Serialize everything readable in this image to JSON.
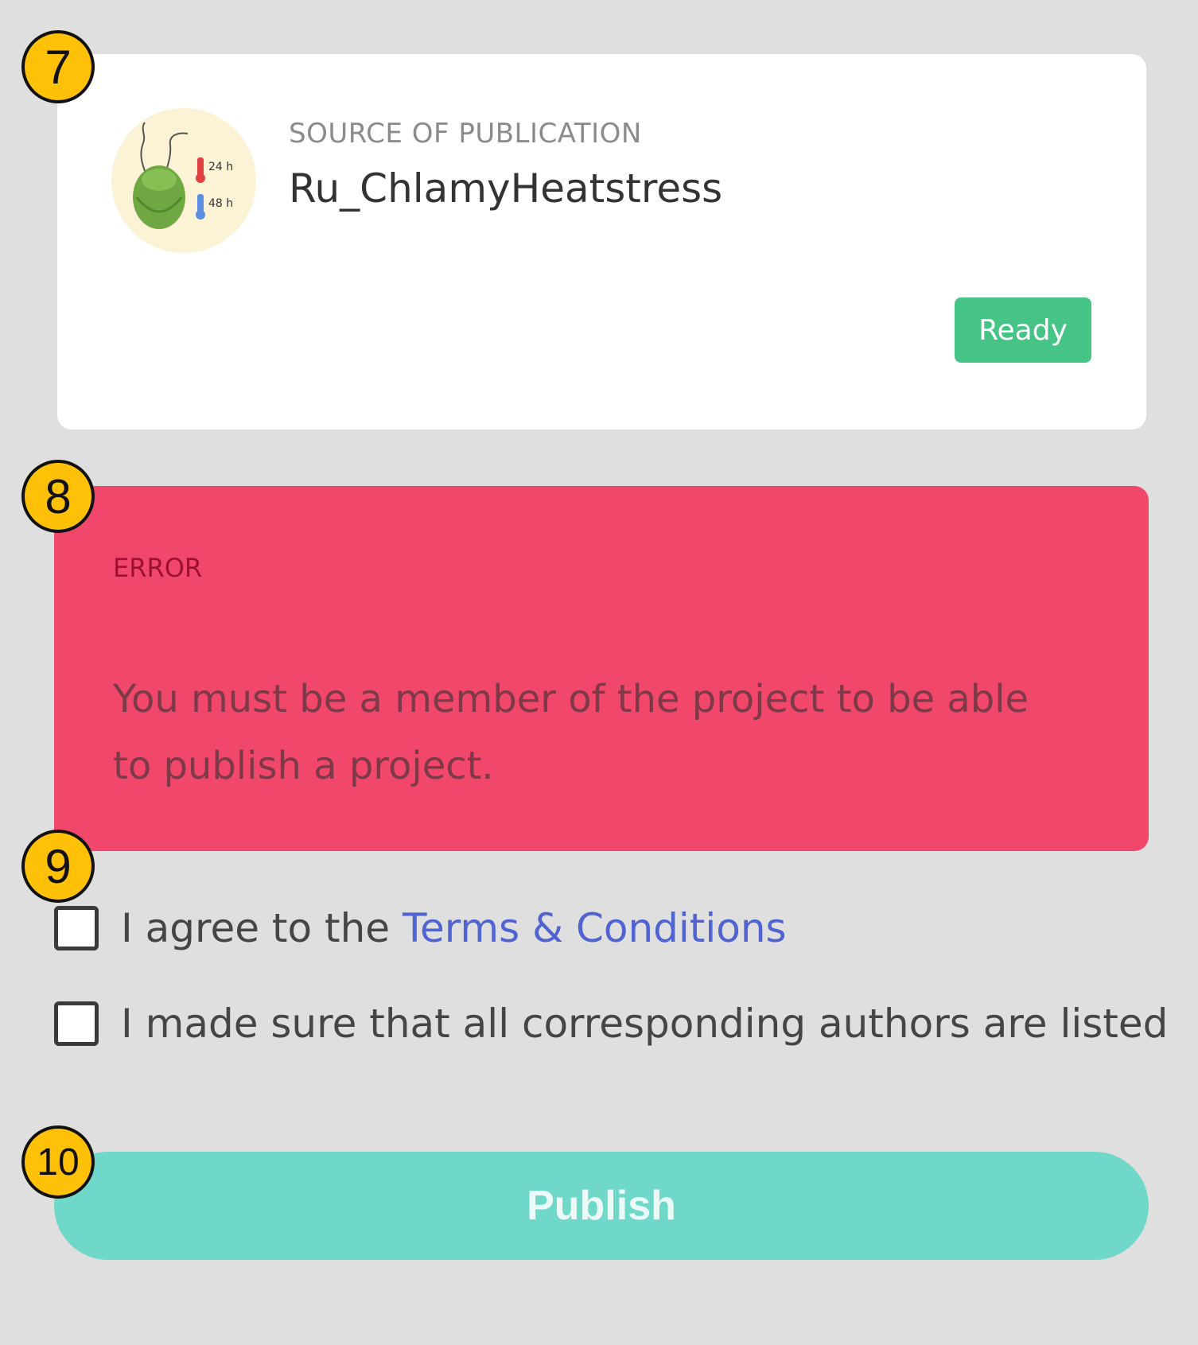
{
  "markers": [
    "7",
    "8",
    "9",
    "10"
  ],
  "source": {
    "label": "SOURCE OF PUBLICATION",
    "name": "Ru_ChlamyHeatstress",
    "status": "Ready",
    "thumbnail_labels": [
      "24 h",
      "48 h"
    ]
  },
  "error": {
    "title": "ERROR",
    "message": "You must be a member of the project to be able to publish a project."
  },
  "checkboxes": {
    "terms_prefix": "I agree to the ",
    "terms_link": "Terms & Conditions",
    "authors": "I made sure that all corresponding authors are listed"
  },
  "publish": {
    "label": "Publish"
  },
  "colors": {
    "background": "#dfdfdf",
    "marker": "#ffc107",
    "ready_badge": "#45c486",
    "error_bg": "#f0476a",
    "link": "#4f63d2",
    "publish_bg": "#6fd8c8"
  }
}
